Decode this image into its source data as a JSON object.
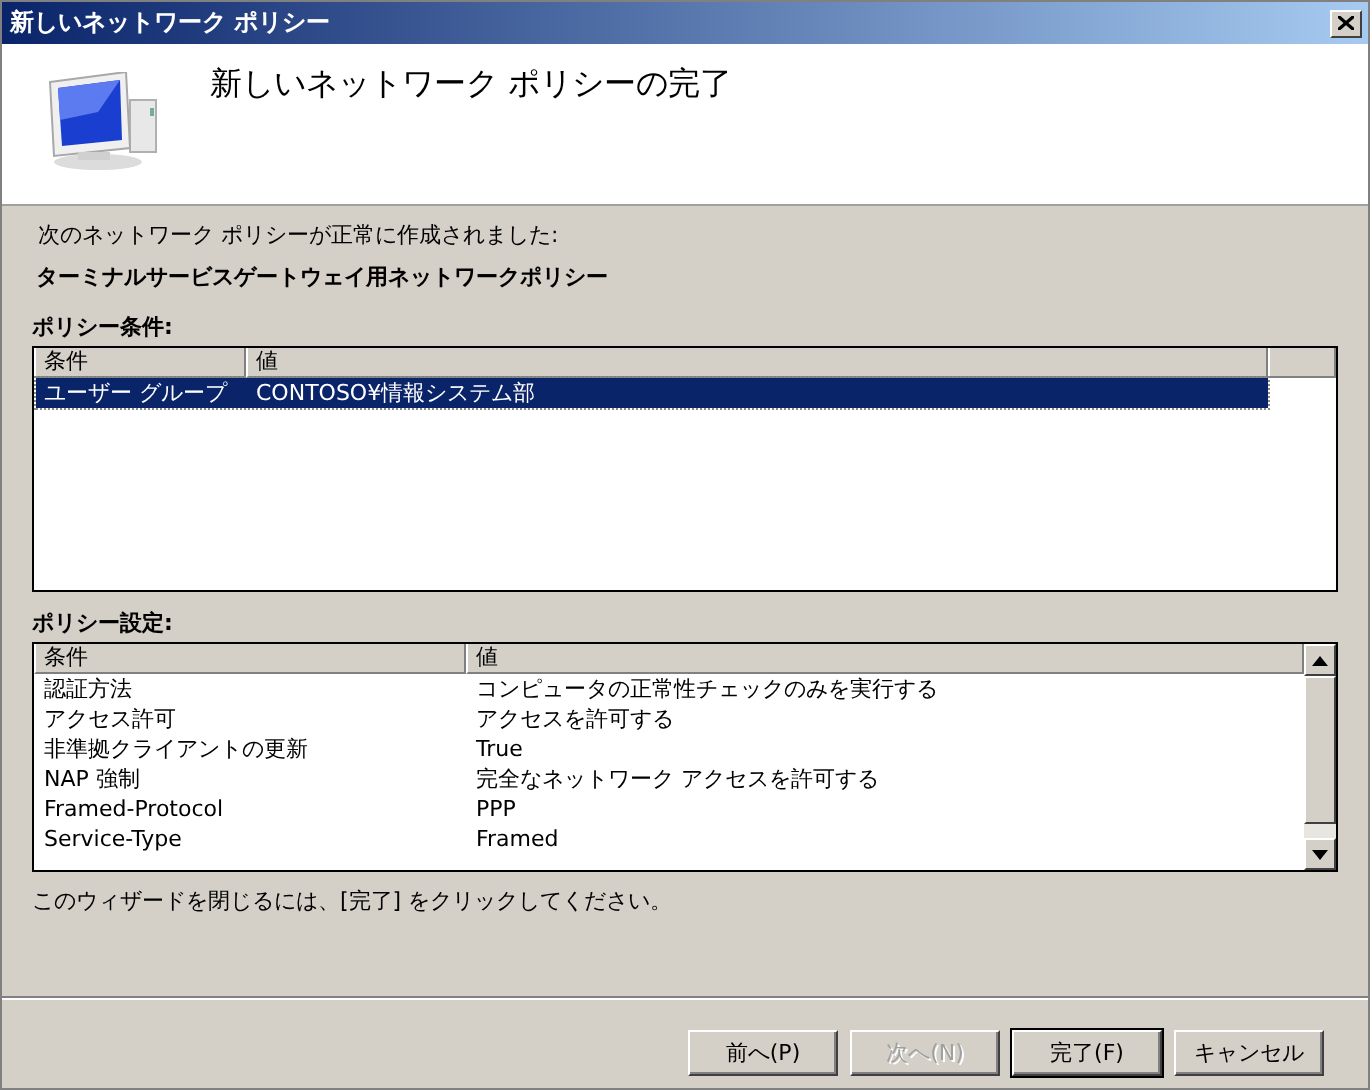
{
  "window": {
    "title": "新しいネットワーク ポリシー"
  },
  "header": {
    "title": "新しいネットワーク ポリシーの完了"
  },
  "intro": "次のネットワーク ポリシーが正常に作成されました:",
  "policy_name": "ターミナルサービスゲートウェイ用ネットワークポリシー",
  "conditions": {
    "label": "ポリシー条件:",
    "columns": [
      "条件",
      "値"
    ],
    "rows": [
      {
        "cells": [
          "ユーザー グループ",
          "CONTOSO¥情報システム部"
        ],
        "selected": true
      }
    ]
  },
  "settings": {
    "label": "ポリシー設定:",
    "columns": [
      "条件",
      "値"
    ],
    "rows": [
      {
        "cells": [
          "認証方法",
          "コンピュータの正常性チェックのみを実行する"
        ],
        "selected": false
      },
      {
        "cells": [
          "アクセス許可",
          "アクセスを許可する"
        ],
        "selected": false
      },
      {
        "cells": [
          "非準拠クライアントの更新",
          "True"
        ],
        "selected": false
      },
      {
        "cells": [
          "NAP 強制",
          "完全なネットワーク アクセスを許可する"
        ],
        "selected": false
      },
      {
        "cells": [
          "Framed-Protocol",
          "PPP"
        ],
        "selected": false
      },
      {
        "cells": [
          "Service-Type",
          "Framed"
        ],
        "selected": false
      }
    ]
  },
  "footer": "このウィザードを閉じるには、[完了] をクリックしてください。",
  "buttons": [
    {
      "label": "前へ(P)",
      "disabled": false,
      "default": false
    },
    {
      "label": "次へ(N)",
      "disabled": true,
      "default": false
    },
    {
      "label": "完了(F)",
      "disabled": false,
      "default": true
    },
    {
      "label": "キャンセル",
      "disabled": false,
      "default": false
    }
  ]
}
